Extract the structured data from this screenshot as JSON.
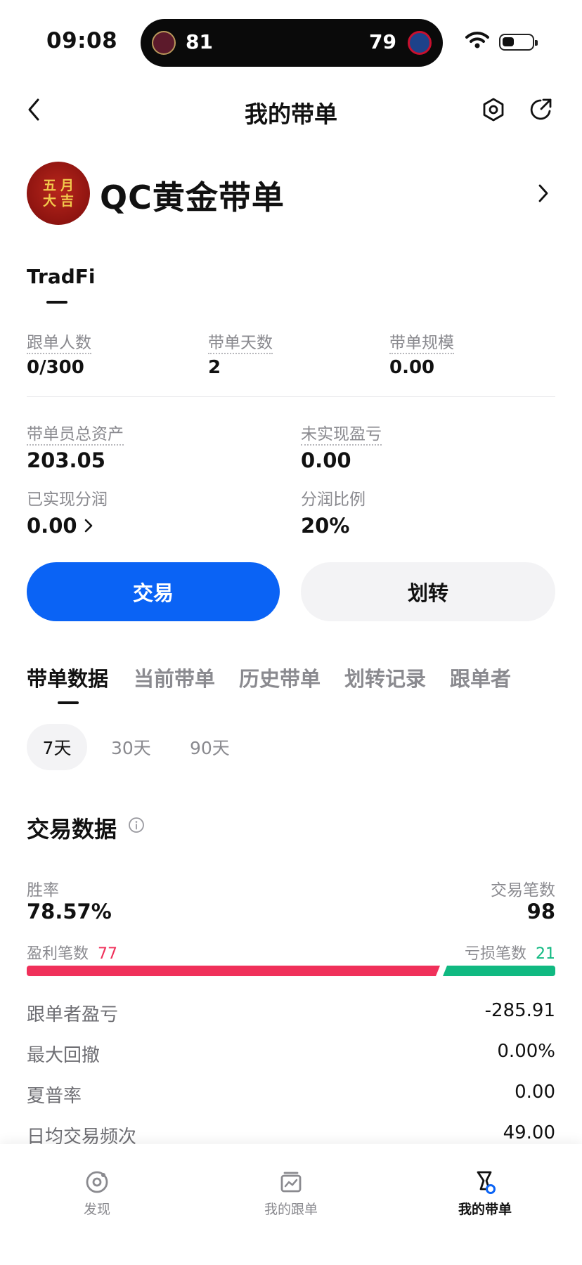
{
  "status_bar": {
    "time": "09:08",
    "score_left": "81",
    "score_right": "79",
    "team_left_icon": "cavaliers-logo-icon",
    "team_right_icon": "pistons-logo-icon"
  },
  "nav": {
    "title": "我的带单",
    "back_icon": "chevron-left-icon",
    "settings_icon": "hexagon-settings-icon",
    "share_icon": "share-icon"
  },
  "profile": {
    "avatar_chars": [
      "五",
      "月",
      "大",
      "吉"
    ],
    "name": "QC黄金带单"
  },
  "category_tab": "TradFi",
  "stats": [
    {
      "label": "跟单人数",
      "value": "0/300"
    },
    {
      "label": "带单天数",
      "value": "2"
    },
    {
      "label": "带单规模",
      "value": "0.00"
    }
  ],
  "assets": {
    "total_label": "带单员总资产",
    "total_value": "203.05",
    "unrealized_label": "未实现盈亏",
    "unrealized_value": "0.00",
    "realized_label": "已实现分润",
    "realized_value": "0.00",
    "ratio_label": "分润比例",
    "ratio_value": "20%"
  },
  "buttons": {
    "trade": "交易",
    "transfer": "划转"
  },
  "tabs": [
    "带单数据",
    "当前带单",
    "历史带单",
    "划转记录",
    "跟单者"
  ],
  "periods": [
    "7天",
    "30天",
    "90天"
  ],
  "trade_data": {
    "title": "交易数据",
    "win_rate_label": "胜率",
    "win_rate_value": "78.57%",
    "trades_label": "交易笔数",
    "trades_value": "98",
    "profit_label": "盈利笔数",
    "profit_count": "77",
    "loss_label": "亏损笔数",
    "loss_count": "21",
    "profit_fraction": 0.7857,
    "profit_color": "#f0305a",
    "loss_color": "#10b981",
    "rows": [
      {
        "label": "跟单者盈亏",
        "value": "-285.91"
      },
      {
        "label": "最大回撤",
        "value": "0.00%"
      },
      {
        "label": "夏普率",
        "value": "0.00"
      },
      {
        "label": "日均交易频次",
        "value": "49.00"
      }
    ]
  },
  "tabbar": [
    {
      "label": "发现",
      "icon": "discover-icon",
      "active": false
    },
    {
      "label": "我的跟单",
      "icon": "copy-trade-icon",
      "active": false
    },
    {
      "label": "我的带单",
      "icon": "lead-trade-icon",
      "active": true
    }
  ],
  "accent_color": "#0a63f5"
}
